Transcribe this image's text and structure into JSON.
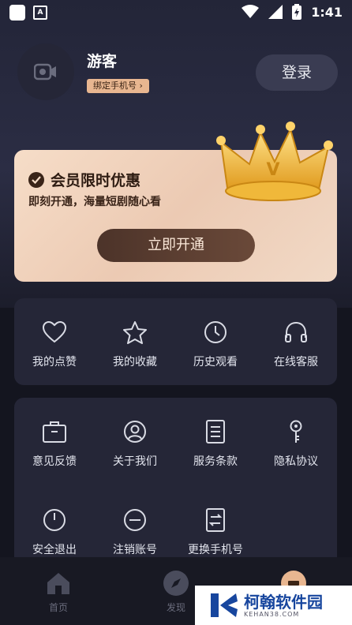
{
  "status_bar": {
    "time": "1:41",
    "badge_letter": "A"
  },
  "profile": {
    "name": "游客",
    "bind_phone": "绑定手机号",
    "login": "登录"
  },
  "vip": {
    "title": "会员限时优惠",
    "subtitle": "即刻开通，海量短剧随心看",
    "button": "立即开通",
    "crown_letter": "V"
  },
  "quick_actions": [
    {
      "label": "我的点赞",
      "icon": "heart-icon"
    },
    {
      "label": "我的收藏",
      "icon": "star-icon"
    },
    {
      "label": "历史观看",
      "icon": "clock-icon"
    },
    {
      "label": "在线客服",
      "icon": "headphones-icon"
    }
  ],
  "settings": [
    {
      "label": "意见反馈",
      "icon": "briefcase-icon"
    },
    {
      "label": "关于我们",
      "icon": "user-circle-icon"
    },
    {
      "label": "服务条款",
      "icon": "document-icon"
    },
    {
      "label": "隐私协议",
      "icon": "key-icon"
    },
    {
      "label": "安全退出",
      "icon": "power-icon"
    },
    {
      "label": "注销账号",
      "icon": "minus-circle-icon"
    },
    {
      "label": "更换手机号",
      "icon": "swap-document-icon"
    }
  ],
  "bottom_nav": [
    {
      "label": "首页",
      "icon": "home-icon"
    },
    {
      "label": "发现",
      "icon": "compass-icon"
    },
    {
      "label": "",
      "icon": "profile-icon"
    }
  ],
  "watermark": {
    "title": "柯翰软件园",
    "url": "KEHAN38.COM"
  },
  "colors": {
    "accent": "#e8b690",
    "panel": "#252637",
    "vip_button": "#5a3e32"
  }
}
